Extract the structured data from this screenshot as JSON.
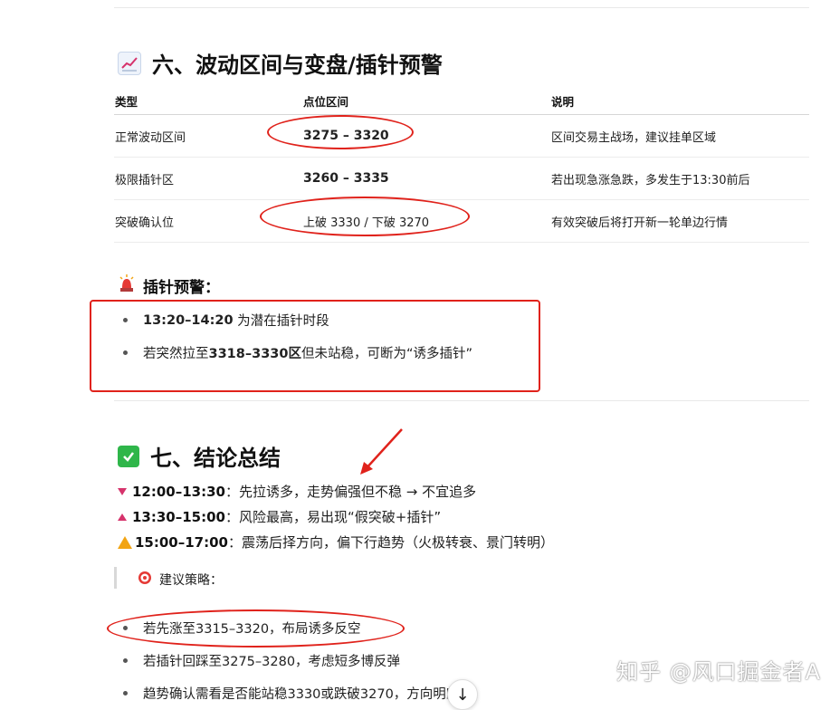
{
  "section6": {
    "title": "六、波动区间与变盘/插针预警",
    "emoji": "chart-increasing-icon",
    "table": {
      "headers": [
        "类型",
        "点位区间",
        "说明"
      ],
      "rows": [
        {
          "type": "正常波动区间",
          "range": "3275 – 3320",
          "note": "区间交易主战场，建议挂单区域"
        },
        {
          "type": "极限插针区",
          "range": "3260 – 3335",
          "note": "若出现急涨急跌，多发生于13:30前后"
        },
        {
          "type": "突破确认位",
          "range": "上破 3330 / 下破 3270",
          "note": "有效突破后将打开新一轮单边行情"
        }
      ]
    }
  },
  "warning": {
    "title": "插针预警：",
    "emoji": "police-light-icon",
    "items": [
      {
        "bold": "13:20–14:20",
        "text": " 为潜在插针时段"
      },
      {
        "pre": "若突然拉至",
        "bold": "3318–3330区",
        "text": "但未站稳，可断为“诱多插针”"
      }
    ]
  },
  "section7": {
    "title": "七、结论总结",
    "emoji": "check-mark-icon",
    "lines": [
      {
        "icon": "red-triangle-down-icon",
        "bold": "12:00–13:30",
        "text": "：先拉诱多，走势偏强但不稳 → 不宜追多"
      },
      {
        "icon": "red-triangle-up-icon",
        "bold": "13:30–15:00",
        "text": "：风险最高，易出现“假突破+插针”"
      },
      {
        "icon": "warning-icon",
        "bold": "15:00–17:00",
        "text": "：震荡后择方向，偏下行趋势（火极转衰、景门转明）"
      }
    ],
    "strategy_label": "建议策略：",
    "strategy_emoji": "target-icon",
    "strategies": [
      "若先涨至3315–3320，布局诱多反空",
      "若插针回踩至3275–3280，考虑短多博反弹",
      "趋势确认需看是否能站稳3330或跌破3270，方向明朗"
    ]
  },
  "watermark": "知乎 @风口掘金者A",
  "colors": {
    "annotation": "#e0221b",
    "accent": "#d6336c"
  }
}
